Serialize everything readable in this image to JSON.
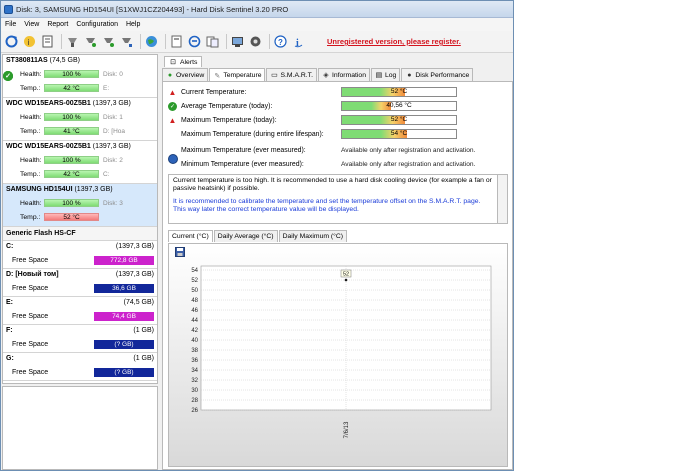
{
  "window": {
    "title": "Disk: 3, SAMSUNG HD154UI [S1XWJ1CZ204493]  -  Hard Disk Sentinel 3.20 PRO"
  },
  "menu": [
    "File",
    "View",
    "Report",
    "Configuration",
    "Help"
  ],
  "toolbar": {
    "icons": [
      "refresh-icon",
      "disk-info-icon",
      "report-icon",
      "test-icon",
      "surface-test-icon",
      "repair-icon",
      "tools-icon",
      "web-icon",
      "save-report-icon",
      "send-icon",
      "copy-icon",
      "options-icon",
      "monitor-icon",
      "help-icon",
      "about-icon"
    ],
    "register_text": "Unregistered version, please register."
  },
  "disks": [
    {
      "name": "ST380811AS",
      "size": "(74,5 GB)",
      "health": "100 %",
      "temp": "42 °C",
      "disk_label": "Disk: 0",
      "drive": "E:",
      "temp_alert": false
    },
    {
      "name": "WDC WD15EARS-00Z5B1",
      "size": "(1397,3 GB)",
      "health": "100 %",
      "temp": "41 °C",
      "disk_label": "Disk: 1",
      "drive": "D: [Hoa",
      "temp_alert": false
    },
    {
      "name": "WDC WD15EARS-00Z5B1",
      "size": "(1397,3 GB)",
      "health": "100 %",
      "temp": "42 °C",
      "disk_label": "Disk: 2",
      "drive": "C:",
      "temp_alert": false
    },
    {
      "name": "SAMSUNG HD154UI",
      "size": "(1397,3 GB)",
      "health": "100 %",
      "temp": "52 °C",
      "disk_label": "Disk: 3",
      "drive": "",
      "temp_alert": true
    }
  ],
  "labels": {
    "health": "Health:",
    "temp": "Temp.:",
    "free_space": "Free Space"
  },
  "flash": {
    "name": "Generic Flash HS-CF"
  },
  "volumes": [
    {
      "letter": "C:",
      "size": "(1397,3 GB)",
      "free": "772,8 GB",
      "color": "magenta"
    },
    {
      "letter": "D: [Новый том]",
      "size": "(1397,3 GB)",
      "free": "36,6 GB",
      "color": "blue"
    },
    {
      "letter": "E:",
      "size": "(74,5 GB)",
      "free": "74,4 GB",
      "color": "magenta"
    },
    {
      "letter": "F:",
      "size": "(1 GB)",
      "free": "(? GB)",
      "color": "blue"
    },
    {
      "letter": "G:",
      "size": "(1 GB)",
      "free": "(? GB)",
      "color": "blue"
    }
  ],
  "alerts_tab": "Alerts",
  "tabs": [
    "Overview",
    "Temperature",
    "S.M.A.R.T.",
    "Information",
    "Log",
    "Disk Performance"
  ],
  "temperature": {
    "current": {
      "label": "Current Temperature:",
      "value": "52 °C",
      "fill": 0.55
    },
    "average": {
      "label": "Average Temperature (today):",
      "value": "40,56 °C",
      "fill": 0.43
    },
    "max_today": {
      "label": "Maximum Temperature (today):",
      "value": "52 °C",
      "fill": 0.55
    },
    "max_life": {
      "label": "Maximum Temperature (during entire lifespan):",
      "value": "54 °C",
      "fill": 0.57
    },
    "max_ever": {
      "label": "Maximum Temperature (ever measured):",
      "value": "Available only after registration and activation."
    },
    "min_ever": {
      "label": "Minimum Temperature (ever measured):",
      "value": "Available only after registration and activation."
    }
  },
  "message": {
    "line1": "Current temperature is too high. It is recommended to use a hard disk cooling device (for example a fan or passive heatsink) if possible.",
    "line2": "It is recommended to calibrate the temperature and set the temperature offset on the S.M.A.R.T. page. This way later the correct temperature value will be displayed."
  },
  "chart_tabs": [
    "Current (°C)",
    "Daily Average (°C)",
    "Daily Maximum (°C)"
  ],
  "chart_data": {
    "type": "scatter",
    "title": "",
    "xlabel": "",
    "ylabel": "",
    "ylim": [
      26,
      54
    ],
    "yticks": [
      54,
      52,
      50,
      48,
      46,
      44,
      42,
      40,
      38,
      36,
      34,
      32,
      30,
      28,
      26
    ],
    "x": [
      "7/6/13"
    ],
    "values": [
      52
    ],
    "data_labels": [
      "52"
    ],
    "grid": true
  }
}
